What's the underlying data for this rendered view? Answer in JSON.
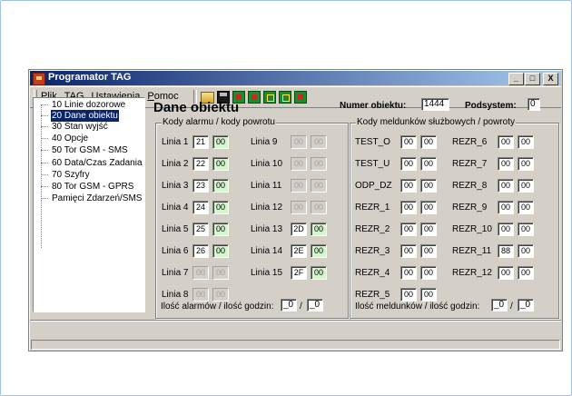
{
  "window": {
    "title": "Programator TAG",
    "buttons": [
      "_",
      "□",
      "X"
    ]
  },
  "menu": [
    "Plik",
    "TAG",
    "Ustawienia",
    "Pomoc"
  ],
  "toolbar_icons": [
    "open-folder-icon",
    "save-icon",
    "device-icon",
    "device-icon",
    "device-icon",
    "device-icon",
    "device-icon"
  ],
  "tree": [
    "10 Linie dozorowe",
    "20 Dane obiektu",
    "30 Stan wyjść",
    "40 Opcje",
    "50 Tor GSM - SMS",
    "60 Data/Czas Zadania",
    "70 Szyfry",
    "80 Tor GSM - GPRS",
    "Pamięci Zdarzeń/SMS"
  ],
  "tree_selected": 1,
  "main": {
    "title": "Dane obiektu",
    "numer_label": "Numer obiektu:",
    "numer_value": "1444",
    "podsystem_label": "Podsystem:",
    "podsystem_value": "0"
  },
  "alarm_group": {
    "caption": "Kody alarmu / kody powrotu",
    "rows": [
      {
        "label": "Linia 1",
        "a": "21",
        "b": "00",
        "enabled": true
      },
      {
        "label": "Linia 2",
        "a": "22",
        "b": "00",
        "enabled": true
      },
      {
        "label": "Linia 3",
        "a": "23",
        "b": "00",
        "enabled": true
      },
      {
        "label": "Linia 4",
        "a": "24",
        "b": "00",
        "enabled": true
      },
      {
        "label": "Linia 5",
        "a": "25",
        "b": "00",
        "enabled": true
      },
      {
        "label": "Linia 6",
        "a": "26",
        "b": "00",
        "enabled": true
      },
      {
        "label": "Linia 7",
        "a": "00",
        "b": "00",
        "enabled": false
      },
      {
        "label": "Linia 8",
        "a": "00",
        "b": "00",
        "enabled": false
      }
    ],
    "rows2": [
      {
        "label": "Linia 9",
        "a": "00",
        "b": "00",
        "enabled": false
      },
      {
        "label": "Linia 10",
        "a": "00",
        "b": "00",
        "enabled": false
      },
      {
        "label": "Linia 11",
        "a": "00",
        "b": "00",
        "enabled": false
      },
      {
        "label": "Linia 12",
        "a": "00",
        "b": "00",
        "enabled": false
      },
      {
        "label": "Linia 13",
        "a": "2D",
        "b": "00",
        "enabled": true
      },
      {
        "label": "Linia 14",
        "a": "2E",
        "b": "00",
        "enabled": true
      },
      {
        "label": "Linia 15",
        "a": "2F",
        "b": "00",
        "enabled": true
      }
    ],
    "footer_label": "Ilość alarmów / ilość godzin:",
    "footer_a": "_0",
    "footer_sep": "/",
    "footer_b": "_0"
  },
  "report_group": {
    "caption": "Kody meldunków służbowych / powroty",
    "rows": [
      {
        "label": "TEST_O",
        "a": "00",
        "b": "00"
      },
      {
        "label": "TEST_U",
        "a": "00",
        "b": "00"
      },
      {
        "label": "ODP_DZ",
        "a": "00",
        "b": "00"
      },
      {
        "label": "REZR_1",
        "a": "00",
        "b": "00"
      },
      {
        "label": "REZR_2",
        "a": "00",
        "b": "00"
      },
      {
        "label": "REZR_3",
        "a": "00",
        "b": "00"
      },
      {
        "label": "REZR_4",
        "a": "00",
        "b": "00"
      },
      {
        "label": "REZR_5",
        "a": "00",
        "b": "00"
      }
    ],
    "rows2": [
      {
        "label": "REZR_6",
        "a": "00",
        "b": "00"
      },
      {
        "label": "REZR_7",
        "a": "00",
        "b": "00"
      },
      {
        "label": "REZR_8",
        "a": "00",
        "b": "00"
      },
      {
        "label": "REZR_9",
        "a": "00",
        "b": "00"
      },
      {
        "label": "REZR_10",
        "a": "00",
        "b": "00"
      },
      {
        "label": "REZR_11",
        "a": "88",
        "b": "00"
      },
      {
        "label": "REZR_12",
        "a": "00",
        "b": "00"
      }
    ],
    "footer_label": "Ilość meldunków / ilość godzin:",
    "footer_a": "_0",
    "footer_sep": "/",
    "footer_b": "_0"
  }
}
